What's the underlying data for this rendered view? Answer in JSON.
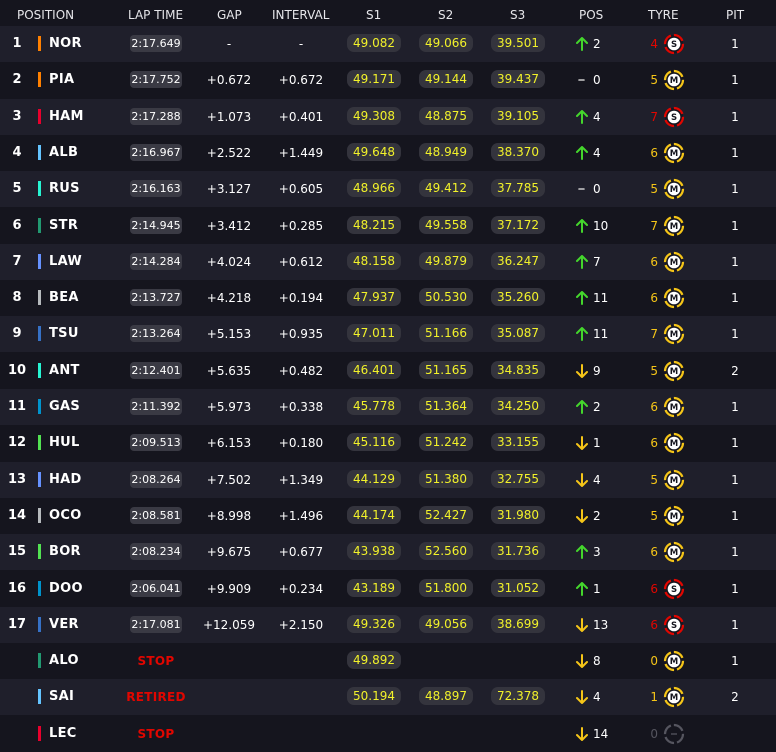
{
  "header": {
    "position": "POSITION",
    "lap_time": "LAP TIME",
    "gap": "GAP",
    "interval": "INTERVAL",
    "s1": "S1",
    "s2": "S2",
    "s3": "S3",
    "pos": "POS",
    "tyre": "TYRE",
    "pit": "PIT"
  },
  "colors": {
    "bg": "#15151e",
    "row_alt": "#1f1f2b",
    "sector_text": "#f2f22a",
    "up": "#44d62c",
    "down": "#f5c518",
    "neutral": "#cccccc",
    "soft": "#e10600",
    "medium": "#f5c518",
    "stop": "#e10600"
  },
  "rows": [
    {
      "position": "1",
      "code": "NOR",
      "team_color": "#ff8000",
      "lap": "2:17.649",
      "status": "",
      "gap": "-",
      "interval": "-",
      "s1": "49.082",
      "s2": "49.066",
      "s3": "39.501",
      "change_dir": "up",
      "change": "2",
      "tyre_age": "4",
      "tyre": "S",
      "tyre_icon": "soft-tyre-icon",
      "pit": "1"
    },
    {
      "position": "2",
      "code": "PIA",
      "team_color": "#ff8000",
      "lap": "2:17.752",
      "status": "",
      "gap": "+0.672",
      "interval": "+0.672",
      "s1": "49.171",
      "s2": "49.144",
      "s3": "39.437",
      "change_dir": "none",
      "change": "0",
      "tyre_age": "5",
      "tyre": "M",
      "tyre_icon": "medium-tyre-icon",
      "pit": "1"
    },
    {
      "position": "3",
      "code": "HAM",
      "team_color": "#e8002d",
      "lap": "2:17.288",
      "status": "",
      "gap": "+1.073",
      "interval": "+0.401",
      "s1": "49.308",
      "s2": "48.875",
      "s3": "39.105",
      "change_dir": "up",
      "change": "4",
      "tyre_age": "7",
      "tyre": "S",
      "tyre_icon": "soft-tyre-icon",
      "pit": "1"
    },
    {
      "position": "4",
      "code": "ALB",
      "team_color": "#64c4ff",
      "lap": "2:16.967",
      "status": "",
      "gap": "+2.522",
      "interval": "+1.449",
      "s1": "49.648",
      "s2": "48.949",
      "s3": "38.370",
      "change_dir": "up",
      "change": "4",
      "tyre_age": "6",
      "tyre": "M",
      "tyre_icon": "medium-tyre-icon",
      "pit": "1"
    },
    {
      "position": "5",
      "code": "RUS",
      "team_color": "#27f4d2",
      "lap": "2:16.163",
      "status": "",
      "gap": "+3.127",
      "interval": "+0.605",
      "s1": "48.966",
      "s2": "49.412",
      "s3": "37.785",
      "change_dir": "none",
      "change": "0",
      "tyre_age": "5",
      "tyre": "M",
      "tyre_icon": "medium-tyre-icon",
      "pit": "1"
    },
    {
      "position": "6",
      "code": "STR",
      "team_color": "#229971",
      "lap": "2:14.945",
      "status": "",
      "gap": "+3.412",
      "interval": "+0.285",
      "s1": "48.215",
      "s2": "49.558",
      "s3": "37.172",
      "change_dir": "up",
      "change": "10",
      "tyre_age": "7",
      "tyre": "M",
      "tyre_icon": "medium-tyre-icon",
      "pit": "1"
    },
    {
      "position": "7",
      "code": "LAW",
      "team_color": "#6692ff",
      "lap": "2:14.284",
      "status": "",
      "gap": "+4.024",
      "interval": "+0.612",
      "s1": "48.158",
      "s2": "49.879",
      "s3": "36.247",
      "change_dir": "up",
      "change": "7",
      "tyre_age": "6",
      "tyre": "M",
      "tyre_icon": "medium-tyre-icon",
      "pit": "1"
    },
    {
      "position": "8",
      "code": "BEA",
      "team_color": "#b6babd",
      "lap": "2:13.727",
      "status": "",
      "gap": "+4.218",
      "interval": "+0.194",
      "s1": "47.937",
      "s2": "50.530",
      "s3": "35.260",
      "change_dir": "up",
      "change": "11",
      "tyre_age": "6",
      "tyre": "M",
      "tyre_icon": "medium-tyre-icon",
      "pit": "1"
    },
    {
      "position": "9",
      "code": "TSU",
      "team_color": "#3671c6",
      "lap": "2:13.264",
      "status": "",
      "gap": "+5.153",
      "interval": "+0.935",
      "s1": "47.011",
      "s2": "51.166",
      "s3": "35.087",
      "change_dir": "up",
      "change": "11",
      "tyre_age": "7",
      "tyre": "M",
      "tyre_icon": "medium-tyre-icon",
      "pit": "1"
    },
    {
      "position": "10",
      "code": "ANT",
      "team_color": "#27f4d2",
      "lap": "2:12.401",
      "status": "",
      "gap": "+5.635",
      "interval": "+0.482",
      "s1": "46.401",
      "s2": "51.165",
      "s3": "34.835",
      "change_dir": "down",
      "change": "9",
      "tyre_age": "5",
      "tyre": "M",
      "tyre_icon": "medium-tyre-icon",
      "pit": "2"
    },
    {
      "position": "11",
      "code": "GAS",
      "team_color": "#0093cc",
      "lap": "2:11.392",
      "status": "",
      "gap": "+5.973",
      "interval": "+0.338",
      "s1": "45.778",
      "s2": "51.364",
      "s3": "34.250",
      "change_dir": "up",
      "change": "2",
      "tyre_age": "6",
      "tyre": "M",
      "tyre_icon": "medium-tyre-icon",
      "pit": "1"
    },
    {
      "position": "12",
      "code": "HUL",
      "team_color": "#52e252",
      "lap": "2:09.513",
      "status": "",
      "gap": "+6.153",
      "interval": "+0.180",
      "s1": "45.116",
      "s2": "51.242",
      "s3": "33.155",
      "change_dir": "down",
      "change": "1",
      "tyre_age": "6",
      "tyre": "M",
      "tyre_icon": "medium-tyre-icon",
      "pit": "1"
    },
    {
      "position": "13",
      "code": "HAD",
      "team_color": "#6692ff",
      "lap": "2:08.264",
      "status": "",
      "gap": "+7.502",
      "interval": "+1.349",
      "s1": "44.129",
      "s2": "51.380",
      "s3": "32.755",
      "change_dir": "down",
      "change": "4",
      "tyre_age": "5",
      "tyre": "M",
      "tyre_icon": "medium-tyre-icon",
      "pit": "1"
    },
    {
      "position": "14",
      "code": "OCO",
      "team_color": "#b6babd",
      "lap": "2:08.581",
      "status": "",
      "gap": "+8.998",
      "interval": "+1.496",
      "s1": "44.174",
      "s2": "52.427",
      "s3": "31.980",
      "change_dir": "down",
      "change": "2",
      "tyre_age": "5",
      "tyre": "M",
      "tyre_icon": "medium-tyre-icon",
      "pit": "1"
    },
    {
      "position": "15",
      "code": "BOR",
      "team_color": "#52e252",
      "lap": "2:08.234",
      "status": "",
      "gap": "+9.675",
      "interval": "+0.677",
      "s1": "43.938",
      "s2": "52.560",
      "s3": "31.736",
      "change_dir": "up",
      "change": "3",
      "tyre_age": "6",
      "tyre": "M",
      "tyre_icon": "medium-tyre-icon",
      "pit": "1"
    },
    {
      "position": "16",
      "code": "DOO",
      "team_color": "#0093cc",
      "lap": "2:06.041",
      "status": "",
      "gap": "+9.909",
      "interval": "+0.234",
      "s1": "43.189",
      "s2": "51.800",
      "s3": "31.052",
      "change_dir": "up",
      "change": "1",
      "tyre_age": "6",
      "tyre": "S",
      "tyre_icon": "soft-tyre-icon",
      "pit": "1"
    },
    {
      "position": "17",
      "code": "VER",
      "team_color": "#3671c6",
      "lap": "2:17.081",
      "status": "",
      "gap": "+12.059",
      "interval": "+2.150",
      "s1": "49.326",
      "s2": "49.056",
      "s3": "38.699",
      "change_dir": "down",
      "change": "13",
      "tyre_age": "6",
      "tyre": "S",
      "tyre_icon": "soft-tyre-icon",
      "pit": "1"
    },
    {
      "position": "",
      "code": "ALO",
      "team_color": "#229971",
      "lap": "",
      "status": "STOP",
      "gap": "",
      "interval": "",
      "s1": "49.892",
      "s2": "",
      "s3": "",
      "change_dir": "down",
      "change": "8",
      "tyre_age": "0",
      "tyre": "M",
      "tyre_icon": "medium-tyre-icon",
      "pit": "1"
    },
    {
      "position": "",
      "code": "SAI",
      "team_color": "#64c4ff",
      "lap": "",
      "status": "RETIRED",
      "gap": "",
      "interval": "",
      "s1": "50.194",
      "s2": "48.897",
      "s3": "72.378",
      "change_dir": "down",
      "change": "4",
      "tyre_age": "1",
      "tyre": "M",
      "tyre_icon": "medium-tyre-icon",
      "pit": "2"
    },
    {
      "position": "",
      "code": "LEC",
      "team_color": "#e8002d",
      "lap": "",
      "status": "STOP",
      "gap": "",
      "interval": "",
      "s1": "",
      "s2": "",
      "s3": "",
      "change_dir": "down",
      "change": "14",
      "tyre_age": "0",
      "tyre": "",
      "tyre_icon": "unknown-tyre-icon",
      "pit": ""
    }
  ]
}
